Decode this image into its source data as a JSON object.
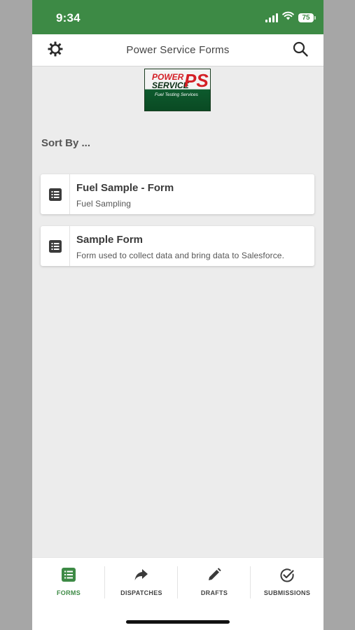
{
  "status_bar": {
    "time": "9:34",
    "battery": "75",
    "icons": [
      "signal-icon",
      "wifi-icon",
      "battery-icon"
    ],
    "color": "#3d8a45"
  },
  "header": {
    "title": "Power Service Forms",
    "left_icon": "gear-icon",
    "right_icon": "search-icon"
  },
  "logo": {
    "line1": "POWER",
    "line2": "SERVICE",
    "mark": "PS",
    "tagline": "Fuel Testing Services"
  },
  "sort_label": "Sort By ...",
  "forms": [
    {
      "title": "Fuel Sample - Form",
      "subtitle": "Fuel Sampling",
      "icon": "list-icon"
    },
    {
      "title": "Sample Form",
      "subtitle": "Form used to collect data and bring data to Salesforce.",
      "icon": "list-icon"
    }
  ],
  "tabs": [
    {
      "label": "FORMS",
      "icon": "forms-icon",
      "active": true
    },
    {
      "label": "DISPATCHES",
      "icon": "share-arrow-icon",
      "active": false
    },
    {
      "label": "DRAFTS",
      "icon": "pencil-icon",
      "active": false
    },
    {
      "label": "SUBMISSIONS",
      "icon": "check-circle-icon",
      "active": false
    }
  ],
  "colors": {
    "accent": "#3d8a45",
    "background": "#ececec"
  }
}
